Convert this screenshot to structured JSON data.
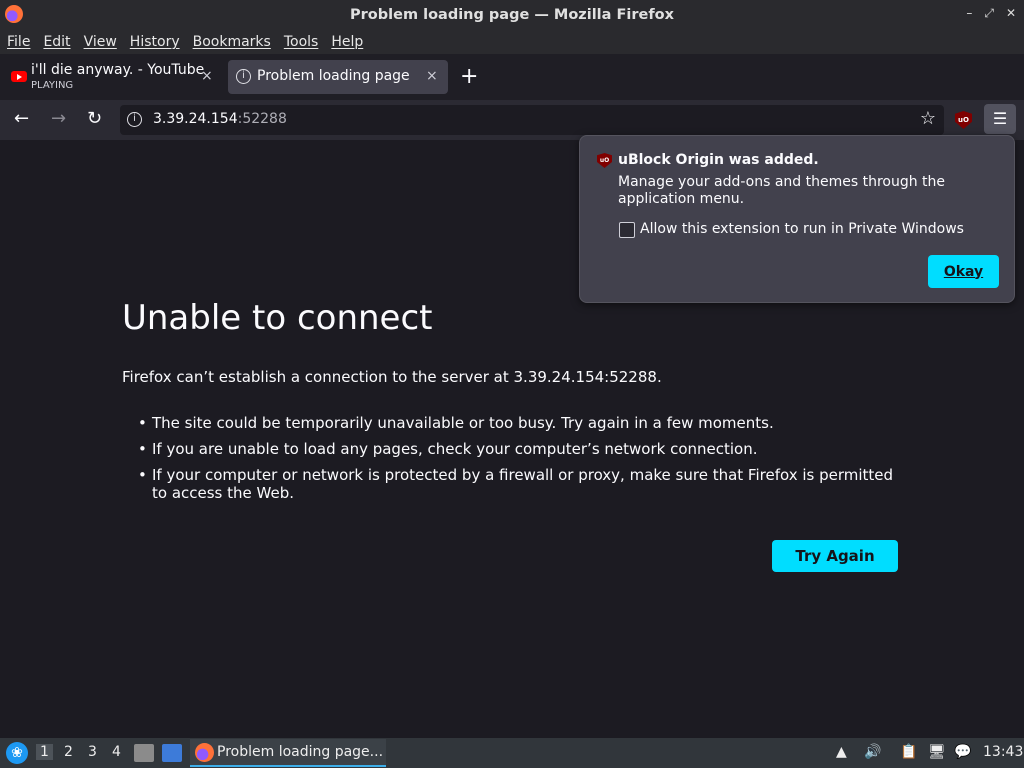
{
  "window": {
    "title": "Problem loading page — Mozilla Firefox",
    "controls": [
      "–",
      "⤢",
      "✕"
    ]
  },
  "menubar": [
    "File",
    "Edit",
    "View",
    "History",
    "Bookmarks",
    "Tools",
    "Help"
  ],
  "tabs": [
    {
      "title": "i'll die anyway. - YouTube",
      "subtitle": "PLAYING",
      "close": "×"
    },
    {
      "title": "Problem loading page",
      "close": "×"
    }
  ],
  "new_tab": "+",
  "navbar": {
    "url_host": "3.39.24.154",
    "url_port": ":52288"
  },
  "error": {
    "title": "Unable to connect",
    "description": "Firefox can’t establish a connection to the server at 3.39.24.154:52288.",
    "items": [
      "The site could be temporarily unavailable or too busy. Try again in a few moments.",
      "If you are unable to load any pages, check your computer’s network connection.",
      "If your computer or network is protected by a firewall or proxy, make sure that Firefox is permitted to access the Web."
    ],
    "button": "Try Again"
  },
  "popup": {
    "title": "uBlock Origin was added.",
    "body": "Manage your add-ons and themes through the application menu.",
    "checkbox_label": "Allow this extension to run in Private Windows",
    "checkbox_checked": false,
    "button": "Okay",
    "icon_text": "uO"
  },
  "taskbar": {
    "workspaces": [
      "1",
      "2",
      "3",
      "4"
    ],
    "active_workspace": "1",
    "task_label": "Problem loading page...",
    "clock": "13:43"
  },
  "colors": {
    "accent": "#00ddff",
    "background": "#1c1b22",
    "popup": "#42414d"
  }
}
